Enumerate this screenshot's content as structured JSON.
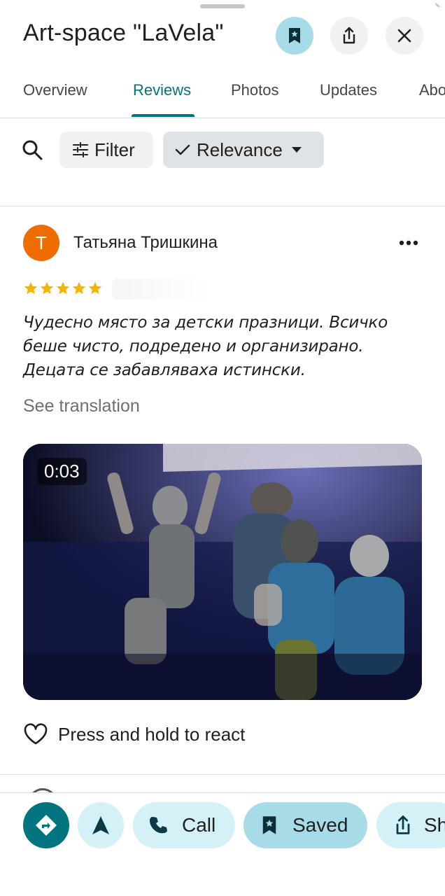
{
  "header": {
    "title": "Art-space \"LaVela\""
  },
  "tabs": [
    {
      "label": "Overview"
    },
    {
      "label": "Reviews"
    },
    {
      "label": "Photos"
    },
    {
      "label": "Updates"
    },
    {
      "label": "Abo"
    }
  ],
  "active_tab": "Reviews",
  "toolbar": {
    "filter_label": "Filter",
    "sort_label": "Relevance"
  },
  "review": {
    "avatar_letter": "T",
    "author": "Татьяна Тришкина",
    "rating": 5,
    "text": "Чудесно място за детски празници. Всичко беше чисто, подредено и организирано. Децата се забавляваха истински.",
    "see_translation": "See translation",
    "video_duration": "0:03",
    "react_label": "Press and hold to react"
  },
  "bottom_actions": {
    "call_label": "Call",
    "saved_label": "Saved",
    "share_label": "Sh"
  },
  "colors": {
    "accent": "#00747f",
    "saved_bg": "#a8dbe8",
    "pill_bg": "#d3f1f7",
    "avatar": "#ef6c00",
    "star": "#f4b400"
  }
}
